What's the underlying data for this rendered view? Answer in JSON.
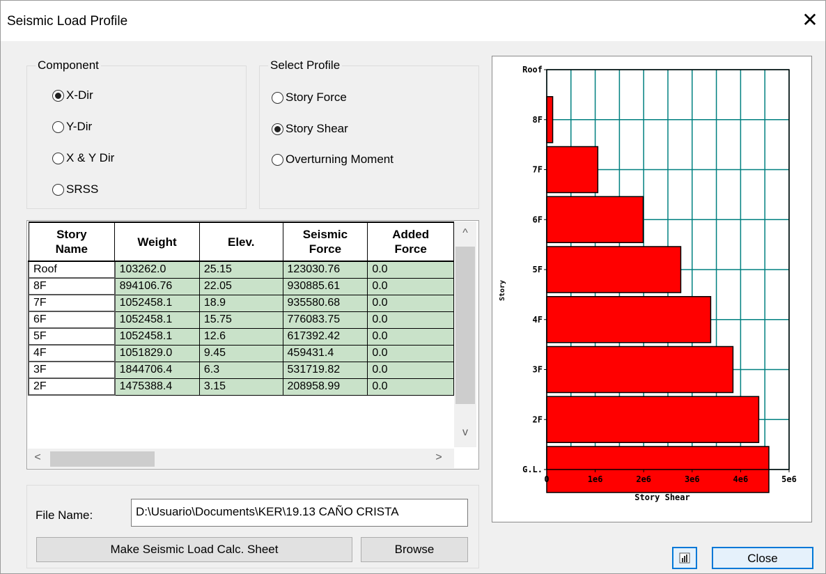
{
  "window": {
    "title": "Seismic Load Profile",
    "close_glyph": "✕"
  },
  "component": {
    "label": "Component",
    "options": [
      "X-Dir",
      "Y-Dir",
      "X & Y Dir",
      "SRSS"
    ],
    "selected": 0
  },
  "profile": {
    "label": "Select Profile",
    "options": [
      "Story Force",
      "Story Shear",
      "Overturning Moment"
    ],
    "selected": 1
  },
  "table": {
    "headers": [
      [
        "Story",
        "Name"
      ],
      [
        "Weight"
      ],
      [
        "Elev."
      ],
      [
        "Seismic",
        "Force"
      ],
      [
        "Added",
        "Force"
      ]
    ],
    "rows": [
      [
        "Roof",
        "103262.0",
        "25.15",
        "123030.76",
        "0.0"
      ],
      [
        "8F",
        "894106.76",
        "22.05",
        "930885.61",
        "0.0"
      ],
      [
        "7F",
        "1052458.1",
        "18.9",
        "935580.68",
        "0.0"
      ],
      [
        "6F",
        "1052458.1",
        "15.75",
        "776083.75",
        "0.0"
      ],
      [
        "5F",
        "1052458.1",
        "12.6",
        "617392.42",
        "0.0"
      ],
      [
        "4F",
        "1051829.0",
        "9.45",
        "459431.4",
        "0.0"
      ],
      [
        "3F",
        "1844706.4",
        "6.3",
        "531719.82",
        "0.0"
      ],
      [
        "2F",
        "1475388.4",
        "3.15",
        "208958.99",
        "0.0"
      ]
    ],
    "scroll_up": "^",
    "scroll_down": "v",
    "scroll_left": "<",
    "scroll_right": ">"
  },
  "file": {
    "label": "File Name:",
    "value": "D:\\Usuario\\Documents\\KER\\19.13 CAÑO CRISTA",
    "make_sheet_label": "Make Seismic Load Calc. Sheet",
    "browse_label": "Browse"
  },
  "footer": {
    "close_label": "Close",
    "chart_button_icon": "bar-chart-icon"
  },
  "colors": {
    "bar": "#ff0000",
    "grid": "#008080",
    "cell": "#c9e2c9",
    "focus": "#0078d7"
  },
  "chart_data": {
    "type": "bar",
    "orientation": "horizontal",
    "xlabel": "Story Shear",
    "ylabel": "Story",
    "categories": [
      "Roof",
      "8F",
      "7F",
      "6F",
      "5F",
      "4F",
      "3F",
      "2F",
      "G.L."
    ],
    "values": [
      0,
      123030.76,
      1053916.37,
      1989497.05,
      2765580.8,
      3382973.22,
      3842404.62,
      4374124.44,
      4583083.43
    ],
    "x_ticks": [
      "0",
      "1e6",
      "2e6",
      "3e6",
      "4e6",
      "5e6"
    ],
    "xlim": [
      0,
      5000000
    ],
    "grid": true
  }
}
